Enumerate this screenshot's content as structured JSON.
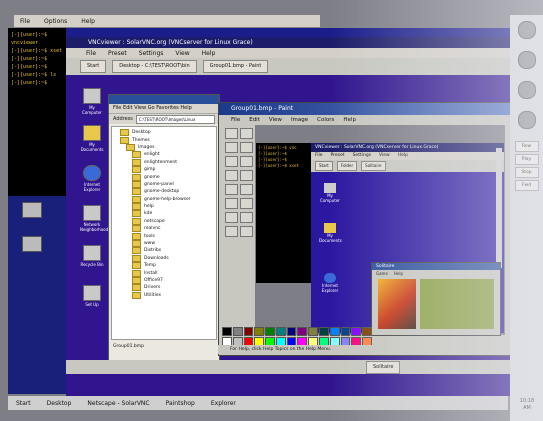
{
  "outer_menu": [
    "File",
    "Options",
    "Help"
  ],
  "left_terminal_lines": [
    "[-]{user}:~$ vncviewer",
    "[-]{user}:~$ xset",
    "[-]{user}:~$",
    "[-]{user}:~$",
    "[-]{user}:~$ ls",
    "[-]{user}:~$"
  ],
  "vnc": {
    "title": "VNCviewer : SolarVNC.org (VNCserver for Linux Grace)",
    "menu": [
      "File",
      "Preset",
      "Settings",
      "View",
      "Help"
    ],
    "taskbar": [
      "Start",
      "Desktop - C:\\TEST\\ROOT\\bin",
      "Group01.bmp - Paint"
    ]
  },
  "inner_desktop_icons": [
    "My Computer",
    "My Documents",
    "Internet Explorer",
    "Network Neighborhood",
    "Recycle Bin",
    "Set Up"
  ],
  "explorer": {
    "menu": "File  Edit  View  Go  Favorites  Help",
    "address_label": "Address",
    "address_value": "C:\\TEST\\ROOT\\Images\\Linux",
    "tree": [
      "Desktop",
      "Themes",
      "Images",
      "enlight",
      "enlightenment",
      "gimp",
      "gnome",
      "gnome-panel",
      "gnome-desktop",
      "gnome-help-browser",
      "help",
      "kde",
      "netscape",
      "realvnc",
      "tools",
      "www",
      "Distribs",
      "Downloads",
      "Temp",
      "Install",
      "Office97",
      "Drivers",
      "Utilities"
    ],
    "footer": "Group01.bmp"
  },
  "paint": {
    "title": "Group01.bmp - Paint",
    "menu": [
      "File",
      "Edit",
      "View",
      "Image",
      "Colors",
      "Help"
    ],
    "status": "For Help, click Help Topics on the Help Menu."
  },
  "nested_terminal_lines": [
    "[-]{user}:~$ vnc",
    "[-]{user}:~$",
    "[-]{user}:~$",
    "[-]{user}:~$ xset"
  ],
  "nested_vnc": {
    "title": "VNCviewer : SolarVNC.org (VNCserver for Linux Grace)",
    "menu": [
      "File",
      "Preset",
      "Settings",
      "View",
      "Help"
    ],
    "taskbar": [
      "Start",
      "Folder",
      "Solitaire"
    ],
    "icons": [
      "My Computer",
      "My Documents",
      "Internet Explorer"
    ],
    "window_title": "Solitaire",
    "window_menu": [
      "Game",
      "Help"
    ]
  },
  "palette_colors": [
    "#000000",
    "#808080",
    "#800000",
    "#808000",
    "#008000",
    "#008080",
    "#000080",
    "#800080",
    "#808040",
    "#004040",
    "#0080ff",
    "#004080",
    "#8000ff",
    "#804000",
    "#ffffff",
    "#c0c0c0",
    "#ff0000",
    "#ffff00",
    "#00ff00",
    "#00ffff",
    "#0000ff",
    "#ff00ff",
    "#ffff80",
    "#00ff80",
    "#80ffff",
    "#8080ff",
    "#ff0080",
    "#ff8040"
  ],
  "inner_bottom_task": [
    "Solitaire"
  ],
  "outer_taskbar": [
    "Start",
    "Desktop",
    "Netscape - SolarVNC",
    "Paintshop",
    "Explorer"
  ],
  "right_panel_buttons": [
    "Rew",
    "Play",
    "Stop",
    "Fwd"
  ],
  "clock": [
    "10:18",
    "AM"
  ]
}
